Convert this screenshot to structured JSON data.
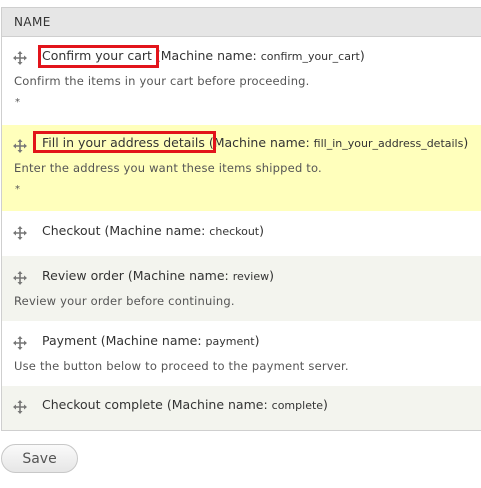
{
  "table": {
    "header": "NAME",
    "machine_name_prefix": "Machine name:",
    "rows": [
      {
        "title": "Confirm your cart",
        "machine_name": "confirm_your_cart",
        "description": "Confirm the items in your cart before proceeding.",
        "required": "*"
      },
      {
        "title": "Fill in your address details",
        "machine_name": "fill_in_your_address_details",
        "description": "Enter the address you want these items shipped to.",
        "required": "*"
      },
      {
        "title": "Checkout",
        "machine_name": "checkout"
      },
      {
        "title": "Review order",
        "machine_name": "review",
        "description": "Review your order before continuing."
      },
      {
        "title": "Payment",
        "machine_name": "payment",
        "description": "Use the button below to proceed to the payment server."
      },
      {
        "title": "Checkout complete",
        "machine_name": "complete"
      }
    ]
  },
  "actions": {
    "save_label": "Save"
  },
  "colors": {
    "highlight_box": "#e2141b",
    "dragged_row": "#ffffbc",
    "striped_row": "#f3f4ee"
  }
}
